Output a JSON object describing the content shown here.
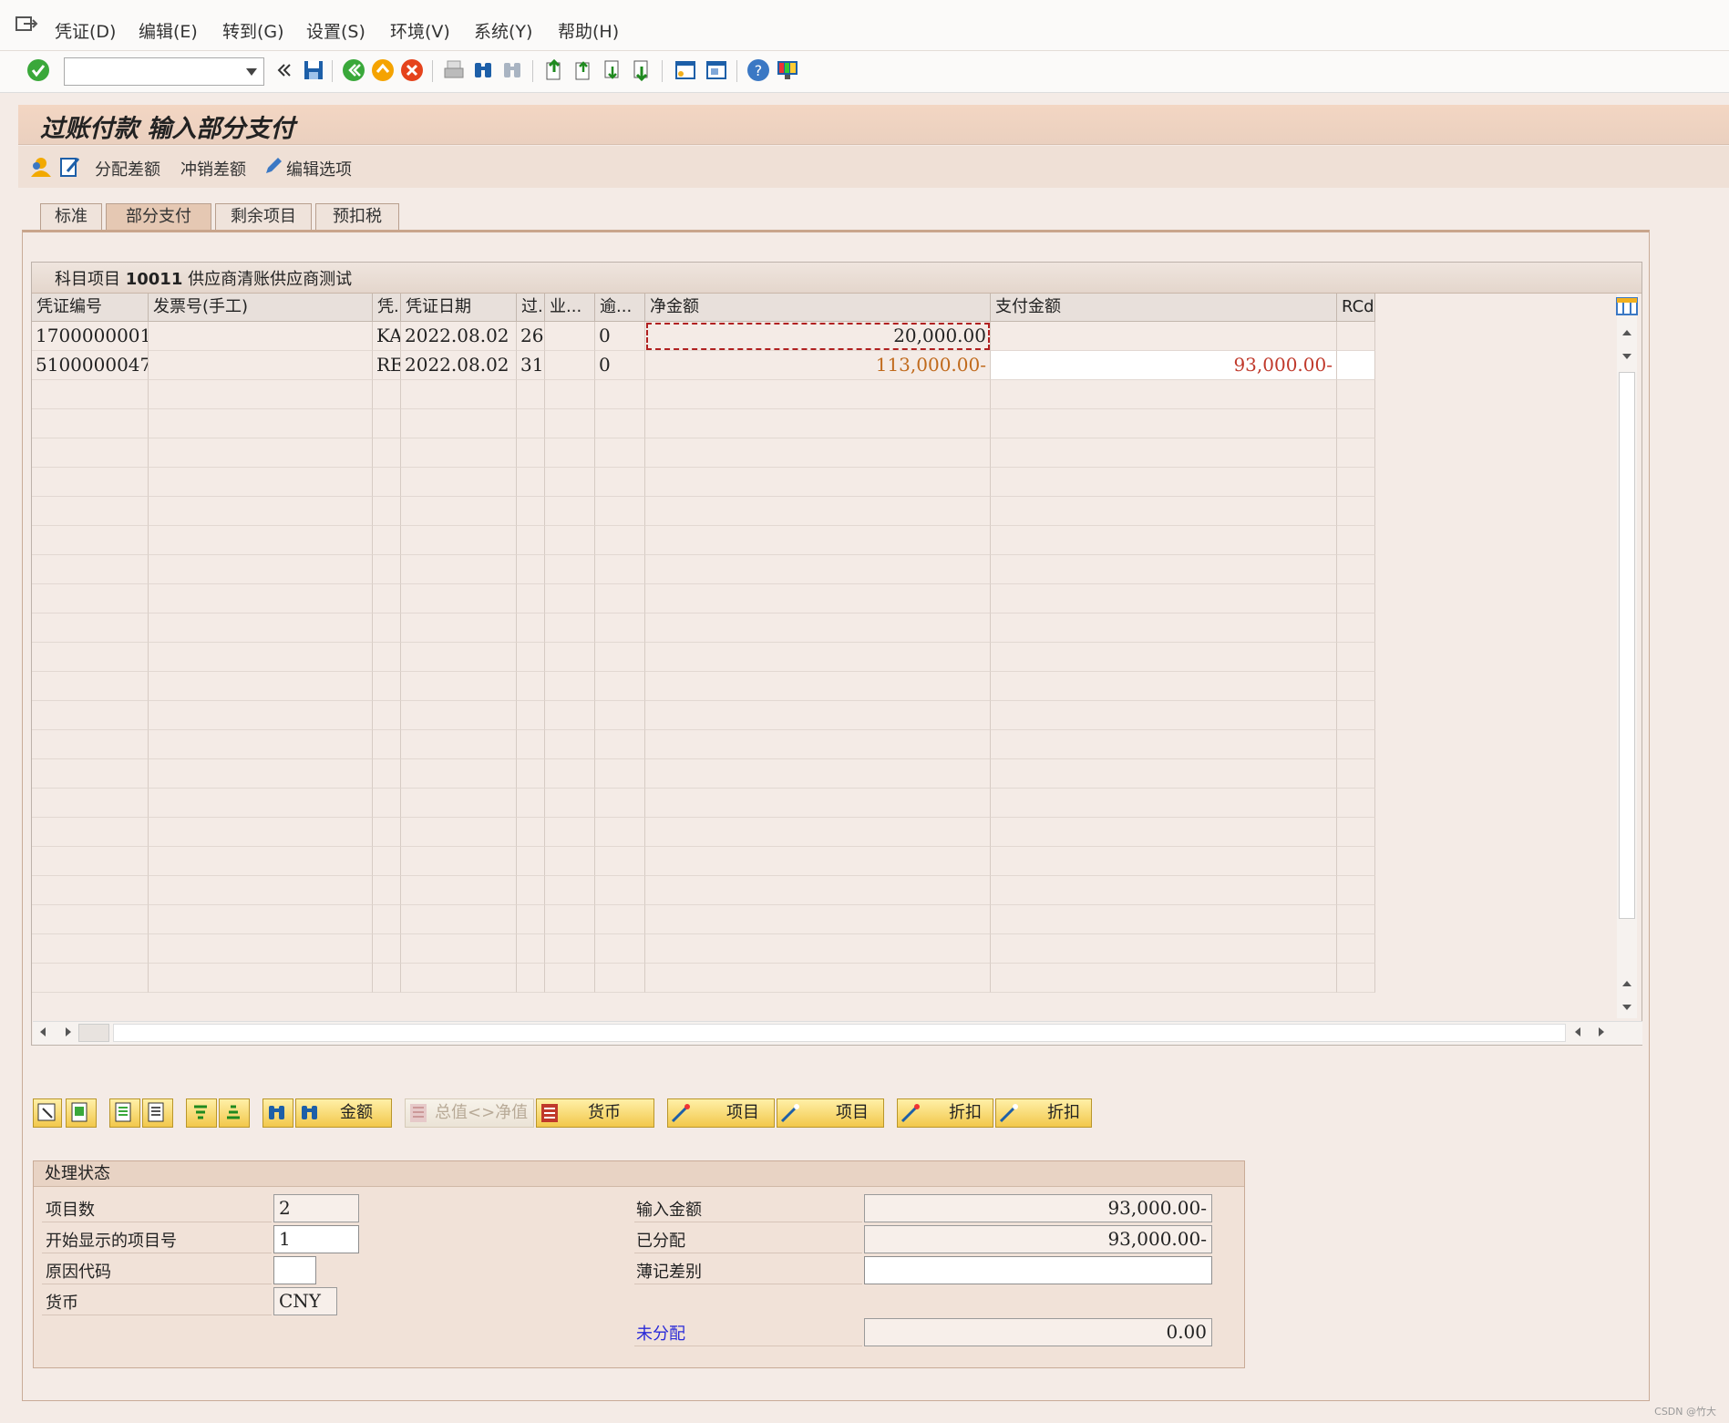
{
  "menu": {
    "items": [
      "凭证(D)",
      "编辑(E)",
      "转到(G)",
      "设置(S)",
      "环境(V)",
      "系统(Y)",
      "帮助(H)"
    ]
  },
  "toolbar": {
    "command_field": "",
    "icons": [
      "enter-icon",
      "back-icon",
      "save-icon",
      "back-green-icon",
      "exit-icon",
      "cancel-icon",
      "print-icon",
      "find-icon",
      "find-next-icon",
      "first-page-icon",
      "prev-page-icon",
      "next-page-icon",
      "last-page-icon",
      "create-session-icon",
      "shortcut-icon",
      "help-icon",
      "customize-icon"
    ]
  },
  "title": "过账付款 输入部分支付",
  "appbar": {
    "distribute_diff": "分配差额",
    "chargeoff_diff": "冲销差额",
    "edit_options": "编辑选项"
  },
  "tabs": [
    "标准",
    "部分支付",
    "剩余项目",
    "预扣税"
  ],
  "table": {
    "title_prefix": "科目项目",
    "account": "10011",
    "vendor": "供应商清账供应商测试",
    "headers": [
      "凭证编号",
      "发票号(手工)",
      "凭.",
      "凭证日期",
      "过.",
      "业...",
      "逾...",
      "净金额",
      "支付金额",
      "RCd"
    ],
    "rows": [
      {
        "doc": "1700000001",
        "inv": "",
        "type": "KA",
        "date": "2022.08.02",
        "pk": "26",
        "biz": "",
        "overdue": "0",
        "net": "20,000.00",
        "pay": "",
        "rcd": ""
      },
      {
        "doc": "5100000047",
        "inv": "",
        "type": "RE",
        "date": "2022.08.02",
        "pk": "31",
        "biz": "",
        "overdue": "0",
        "net": "113,000.00-",
        "pay": "93,000.00-",
        "rcd": ""
      }
    ]
  },
  "bottom_buttons": {
    "amount": "金额",
    "gross_net": "总值<>净值",
    "currency": "货币",
    "item1": "项目",
    "item2": "项目",
    "discount1": "折扣",
    "discount2": "折扣"
  },
  "status": {
    "header": "处理状态",
    "item_count_label": "项目数",
    "item_count": "2",
    "start_item_label": "开始显示的项目号",
    "start_item": "1",
    "reason_label": "原因代码",
    "reason": "",
    "currency_label": "货币",
    "currency": "CNY",
    "entered_label": "输入金额",
    "entered": "93,000.00-",
    "assigned_label": "已分配",
    "assigned": "93,000.00-",
    "diff_label": "薄记差别",
    "diff": "",
    "unassigned_label": "未分配",
    "unassigned": "0.00"
  },
  "watermark": "CSDN @竹大",
  "colors": {
    "negative": "#c0392b",
    "net_negative": "#c06a1c",
    "link": "#2a2ad8",
    "accent": "#e5c8b3"
  }
}
